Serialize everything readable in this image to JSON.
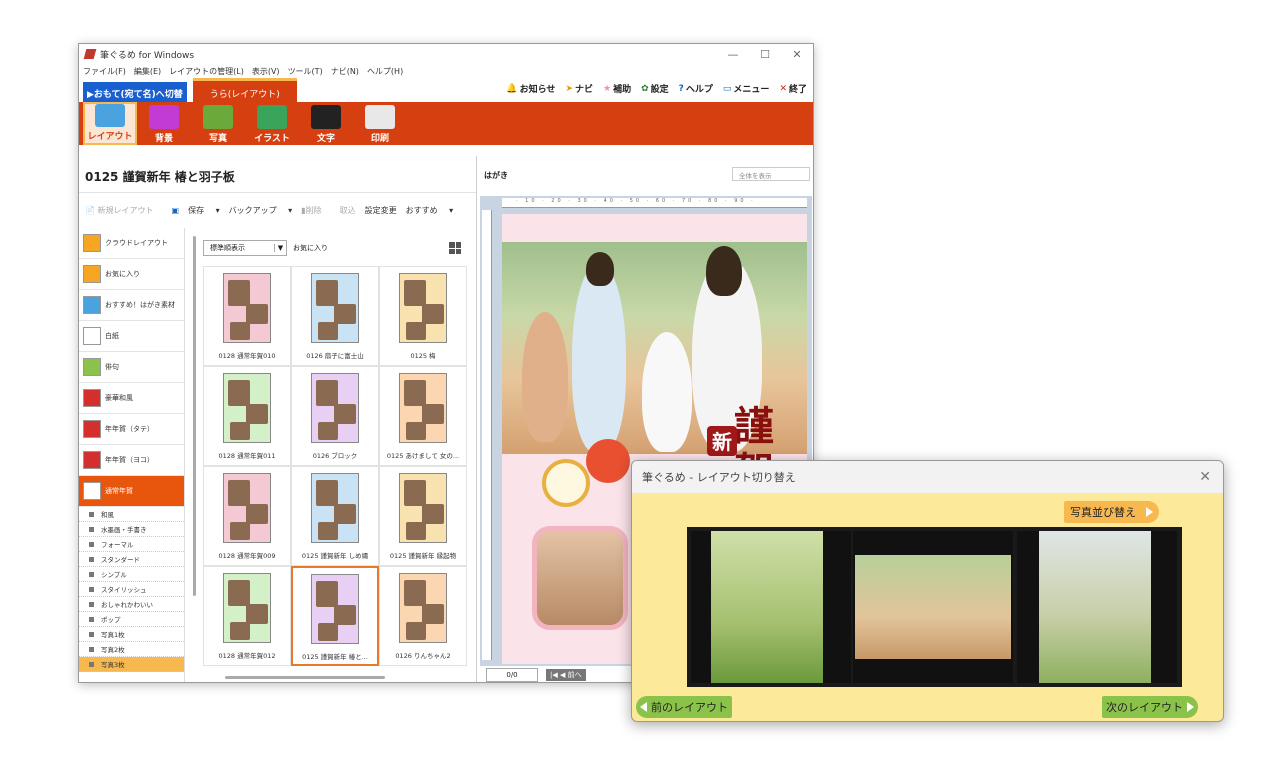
{
  "window": {
    "title": "筆ぐるめ for Windows",
    "controls": [
      "—",
      "☐",
      "✕"
    ]
  },
  "menubar": [
    "ファイル(F)",
    "編集(E)",
    "レイアウトの管理(L)",
    "表示(V)",
    "ツール(T)",
    "ナビ(N)",
    "ヘルプ(H)"
  ],
  "tabs": {
    "front": "▶おもて(宛て名)へ切替",
    "back": "うら(レイアウト)"
  },
  "toplinks": [
    {
      "icon": "bell-icon",
      "label": "お知らせ",
      "color": "#d32f2f"
    },
    {
      "icon": "navi-icon",
      "label": "ナビ",
      "color": "#e89a00"
    },
    {
      "icon": "star-icon",
      "label": "補助",
      "color": "#f48fb1"
    },
    {
      "icon": "gear-icon",
      "label": "設定",
      "color": "#2e7d32"
    },
    {
      "icon": "help-icon",
      "label": "ヘルプ",
      "color": "#1565c0"
    },
    {
      "icon": "menu-icon",
      "label": "メニュー",
      "color": "#1565c0"
    },
    {
      "icon": "close-icon",
      "label": "終了",
      "color": "#c62828"
    }
  ],
  "ribbon": [
    {
      "label": "レイアウト",
      "icon": "layout-icon",
      "color": "#4aa3df",
      "selected": true
    },
    {
      "label": "背景",
      "icon": "background-icon",
      "color": "#c23bd4",
      "selected": false
    },
    {
      "label": "写真",
      "icon": "photo-icon",
      "color": "#6aaa3a",
      "selected": false
    },
    {
      "label": "イラスト",
      "icon": "illust-icon",
      "color": "#3aa55a",
      "selected": false
    },
    {
      "label": "文字",
      "icon": "text-icon",
      "color": "#222222",
      "selected": false
    },
    {
      "label": "印刷",
      "icon": "printer-icon",
      "color": "#e8e8e8",
      "selected": false
    }
  ],
  "layout_title": "0125 謹賀新年 椿と羽子板",
  "toolbar": {
    "new": "新規レイアウト",
    "save": "保存",
    "backup": "バックアップ",
    "delete": "削除",
    "import": "取込",
    "settings": "設定変更",
    "recommend": "おすすめ"
  },
  "categories": [
    {
      "label": "クラウドレイアウト",
      "color": "#f5a623"
    },
    {
      "label": "お気に入り",
      "color": "#f5a623"
    },
    {
      "label": "おすすめ！はがき素材",
      "color": "#4aa3df"
    },
    {
      "label": "白紙",
      "color": "#ffffff"
    },
    {
      "label": "俳句",
      "color": "#8bc34a"
    },
    {
      "label": "豪華和風",
      "color": "#d32f2f"
    },
    {
      "label": "年年賀（タテ）",
      "color": "#d32f2f"
    },
    {
      "label": "年年賀（ヨコ）",
      "color": "#d32f2f"
    },
    {
      "label": "通常年賀",
      "color": "#ffffff",
      "active": true
    }
  ],
  "subcategories": [
    {
      "label": "和風"
    },
    {
      "label": "水墨画・手書き"
    },
    {
      "label": "フォーマル"
    },
    {
      "label": "スタンダード"
    },
    {
      "label": "シンプル"
    },
    {
      "label": "スタイリッシュ"
    },
    {
      "label": "おしゃれかわいい"
    },
    {
      "label": "ポップ"
    },
    {
      "label": "写真1枚"
    },
    {
      "label": "写真2枚"
    },
    {
      "label": "写真3枚",
      "highlight": true
    }
  ],
  "sort": {
    "value": "標準順表示",
    "favorite": "お気に入り"
  },
  "thumbnails": [
    {
      "caption": "0128 通常年賀010"
    },
    {
      "caption": "0126 扇子に富士山"
    },
    {
      "caption": "0125 梅"
    },
    {
      "caption": "0128 通常年賀011"
    },
    {
      "caption": "0126 ブロック"
    },
    {
      "caption": "0125 あけまして 女の..."
    },
    {
      "caption": "0128 通常年賀009"
    },
    {
      "caption": "0125 謹賀新年 しめ縄"
    },
    {
      "caption": "0125 謹賀新年 縁起物"
    },
    {
      "caption": "0128 通常年賀012"
    },
    {
      "caption": "0125 謹賀新年 椿と..."
    },
    {
      "caption": "0126 りんちゃん2"
    }
  ],
  "preview": {
    "paper": "はがき",
    "zoom": "全体を表示",
    "ruler": "· 10 · 20 · 30 · 40 · 50 · 60 · 70 · 80 · 90 ·",
    "page": "0/0",
    "nav": "|◀ ◀ 前へ",
    "greeting": [
      "謹",
      "賀"
    ],
    "badge": "新"
  },
  "dialog": {
    "title": "筆ぐるめ - レイアウト切り替え",
    "sort_button": "写真並び替え",
    "prev": "前のレイアウト",
    "next": "次のレイアウト"
  }
}
